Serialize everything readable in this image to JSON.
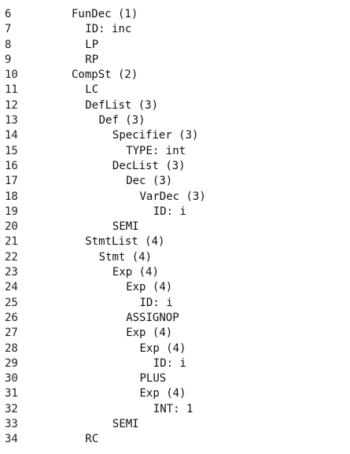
{
  "lines": [
    {
      "num": "6",
      "text": "FunDec (1)",
      "depth": 0
    },
    {
      "num": "7",
      "text": "ID: inc",
      "depth": 1
    },
    {
      "num": "8",
      "text": "LP",
      "depth": 1
    },
    {
      "num": "9",
      "text": "RP",
      "depth": 1
    },
    {
      "num": "10",
      "text": "CompSt (2)",
      "depth": 0
    },
    {
      "num": "11",
      "text": "LC",
      "depth": 1
    },
    {
      "num": "12",
      "text": "DefList (3)",
      "depth": 1
    },
    {
      "num": "13",
      "text": "Def (3)",
      "depth": 2
    },
    {
      "num": "14",
      "text": "Specifier (3)",
      "depth": 3
    },
    {
      "num": "15",
      "text": "TYPE: int",
      "depth": 4
    },
    {
      "num": "16",
      "text": "DecList (3)",
      "depth": 3
    },
    {
      "num": "17",
      "text": "Dec (3)",
      "depth": 4
    },
    {
      "num": "18",
      "text": "VarDec (3)",
      "depth": 5
    },
    {
      "num": "19",
      "text": "ID: i",
      "depth": 6
    },
    {
      "num": "20",
      "text": "SEMI",
      "depth": 3
    },
    {
      "num": "21",
      "text": "StmtList (4)",
      "depth": 1
    },
    {
      "num": "22",
      "text": "Stmt (4)",
      "depth": 2
    },
    {
      "num": "23",
      "text": "Exp (4)",
      "depth": 3
    },
    {
      "num": "24",
      "text": "Exp (4)",
      "depth": 4
    },
    {
      "num": "25",
      "text": "ID: i",
      "depth": 5
    },
    {
      "num": "26",
      "text": "ASSIGNOP",
      "depth": 4
    },
    {
      "num": "27",
      "text": "Exp (4)",
      "depth": 4
    },
    {
      "num": "28",
      "text": "Exp (4)",
      "depth": 5
    },
    {
      "num": "29",
      "text": "ID: i",
      "depth": 6
    },
    {
      "num": "30",
      "text": "PLUS",
      "depth": 5
    },
    {
      "num": "31",
      "text": "Exp (4)",
      "depth": 5
    },
    {
      "num": "32",
      "text": "INT: 1",
      "depth": 6
    },
    {
      "num": "33",
      "text": "SEMI",
      "depth": 3
    },
    {
      "num": "34",
      "text": "RC",
      "depth": 1
    }
  ]
}
